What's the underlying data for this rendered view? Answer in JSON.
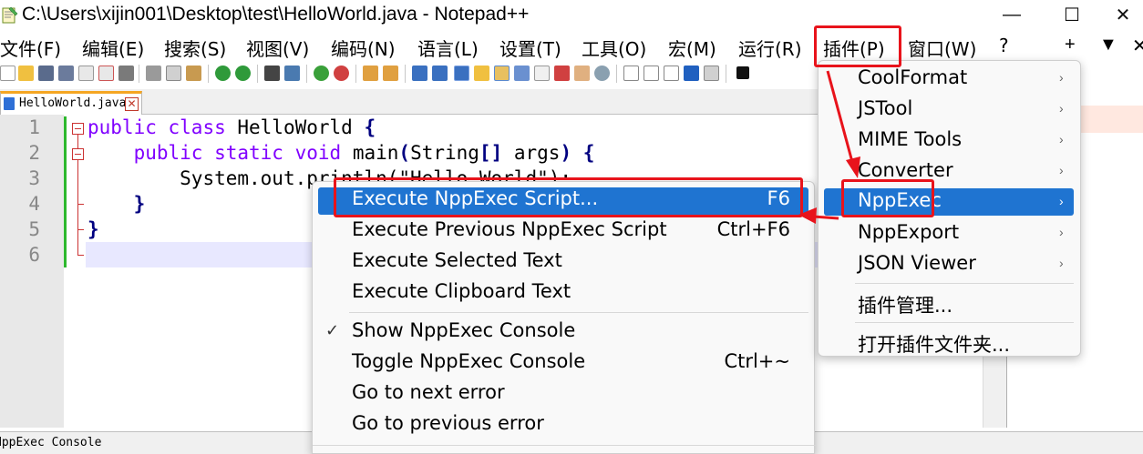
{
  "window": {
    "title": "C:\\Users\\xijin001\\Desktop\\test\\HelloWorld.java - Notepad++",
    "minimize": "—",
    "maximize": "☐",
    "close": "✕"
  },
  "menubar": {
    "items": [
      "文件(F)",
      "编辑(E)",
      "搜索(S)",
      "视图(V)",
      "编码(N)",
      "语言(L)",
      "设置(T)",
      "工具(O)",
      "宏(M)",
      "运行(R)",
      "插件(P)",
      "窗口(W)",
      "?"
    ],
    "extras": [
      "+",
      "▼",
      "✕"
    ]
  },
  "tabs": [
    {
      "label": "HelloWorld.java",
      "close": "✕"
    }
  ],
  "editor": {
    "line_numbers": [
      "1",
      "2",
      "3",
      "4",
      "5",
      "6"
    ],
    "lines": [
      {
        "kw1": "public",
        "kw2": "class",
        "rest": " HelloWorld ",
        "brace": "{"
      },
      {
        "indent": "    ",
        "kw1": "public",
        "kw2": "static",
        "kw3": "void",
        "rest": " main",
        "paren": "(",
        "type": "String",
        "brackets": "[]",
        "arg": " args",
        "paren2": ")",
        "brace": " {"
      },
      {
        "indent": "        ",
        "text": "System.out.println(\"Hello World\");"
      },
      {
        "indent": "    ",
        "brace": "}"
      },
      {
        "brace": "}"
      },
      {
        "text": ""
      }
    ]
  },
  "console_bar": {
    "label": "NppExec Console"
  },
  "plugins_menu": {
    "items": [
      {
        "label": "CoolFormat",
        "submenu": "›"
      },
      {
        "label": "JSTool",
        "submenu": "›"
      },
      {
        "label": "MIME Tools",
        "submenu": "›"
      },
      {
        "label": "Converter",
        "submenu": "›"
      },
      {
        "label": "NppExec",
        "submenu": "›",
        "highlighted": true
      },
      {
        "label": "NppExport",
        "submenu": "›"
      },
      {
        "label": "JSON Viewer",
        "submenu": "›"
      },
      {
        "label": "插件管理..."
      },
      {
        "label": "打开插件文件夹..."
      }
    ]
  },
  "nppexec_menu": {
    "items": [
      {
        "label": "Execute NppExec Script...",
        "shortcut": "F6",
        "highlighted": true
      },
      {
        "label": "Execute Previous NppExec Script",
        "shortcut": "Ctrl+F6"
      },
      {
        "label": "Execute Selected Text"
      },
      {
        "label": "Execute Clipboard Text"
      },
      {
        "label": "Show NppExec Console",
        "checked": "✓"
      },
      {
        "label": "Toggle NppExec Console",
        "shortcut": "Ctrl+~"
      },
      {
        "label": "Go to next error"
      },
      {
        "label": "Go to previous error"
      }
    ]
  },
  "colors": {
    "highlight": "#1f74d1",
    "annotation_red": "#e8131b",
    "keyword": "#8000ff",
    "type_keyword": "#0000ff",
    "current_line": "#e8e8ff",
    "tab_accent": "#f5a623"
  }
}
